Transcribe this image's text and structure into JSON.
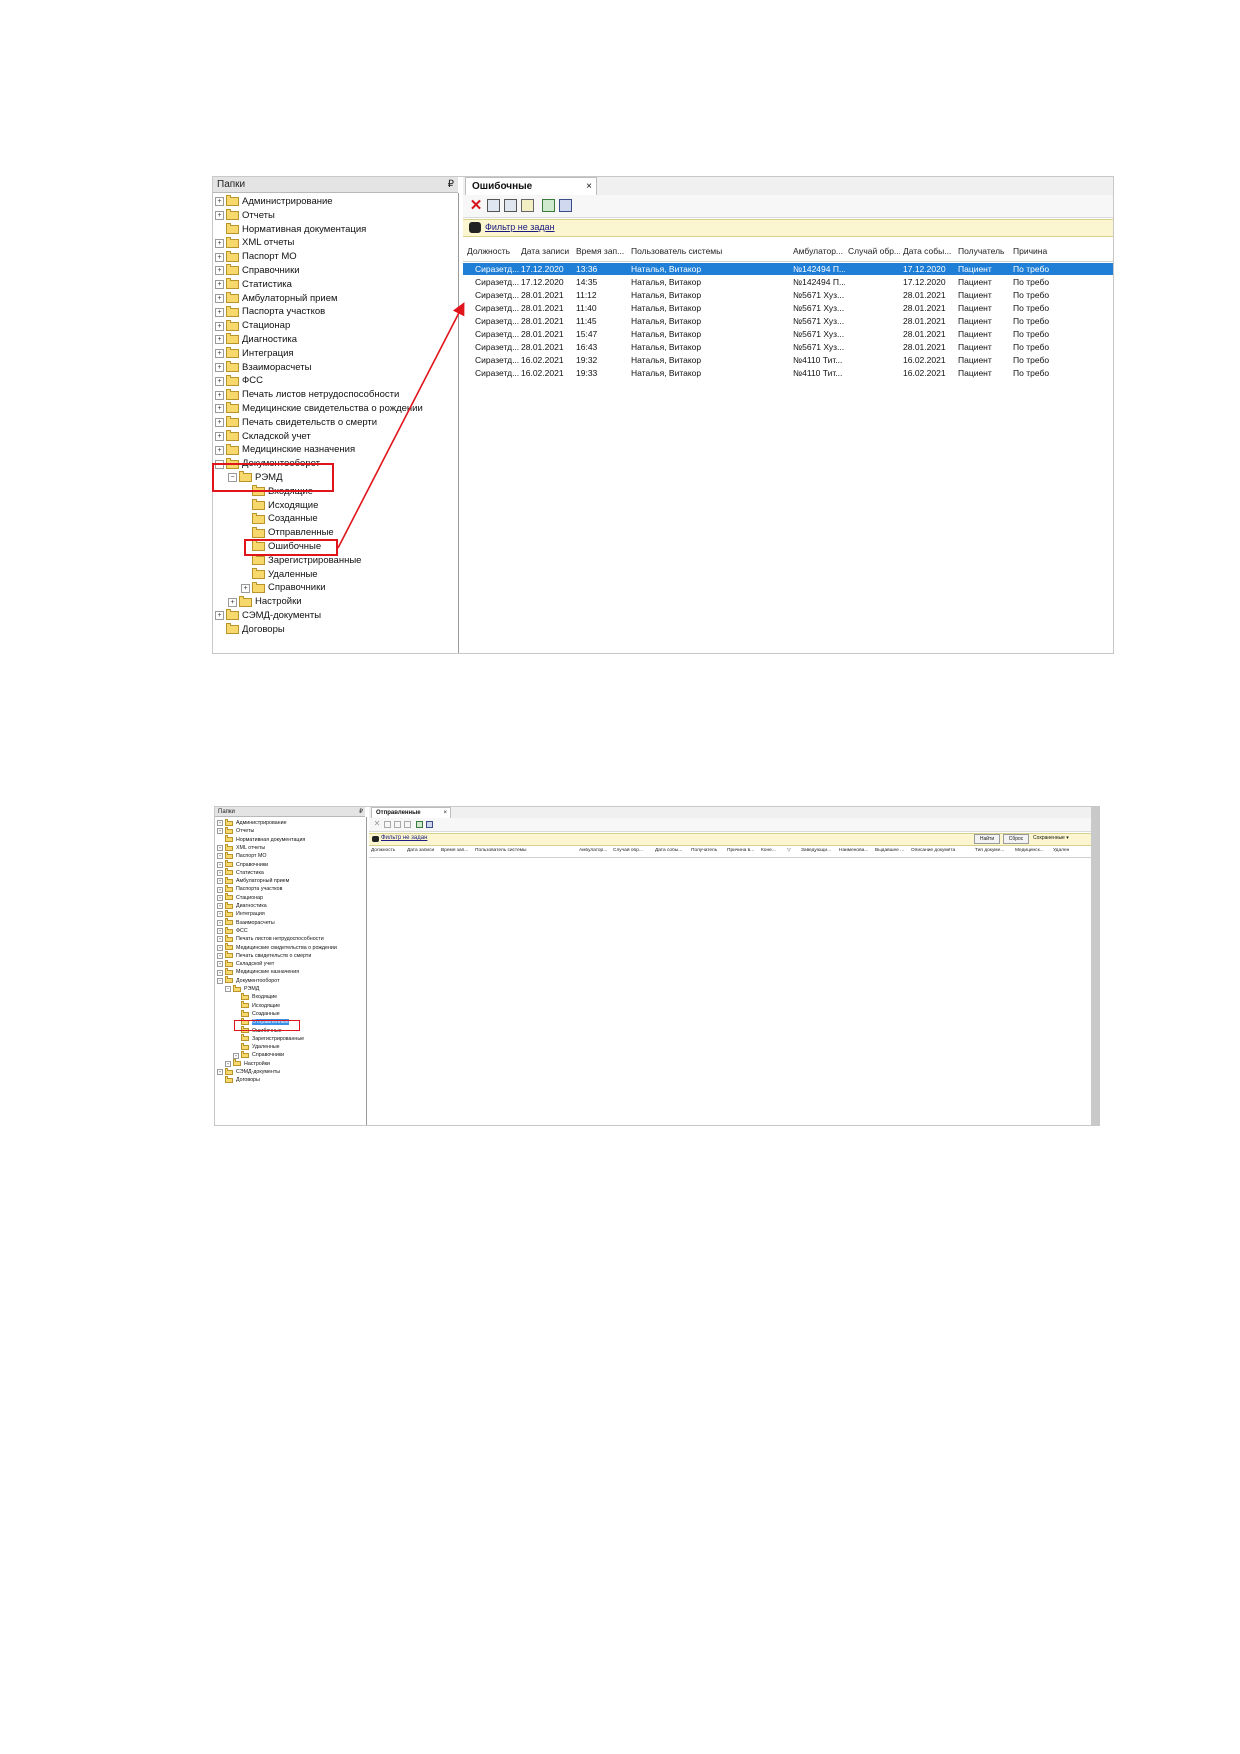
{
  "folders_header": "Папки",
  "pin_glyph": "₽",
  "tree_items": [
    "Администрирование",
    "Отчеты",
    "Нормативная документация",
    "XML отчеты",
    "Паспорт МО",
    "Справочники",
    "Статистика",
    "Амбулаторный прием",
    "Паспорта участков",
    "Стационар",
    "Диагностика",
    "Интеграция",
    "Взаиморасчеты",
    "ФСС",
    "Печать листов нетрудоспособности",
    "Медицинские свидетельства о рождении",
    "Печать свидетельств о смерти",
    "Складской учет",
    "Медицинские назначения",
    "Документооборот",
    "РЭМД",
    "Входящие",
    "Исходящие",
    "Созданные",
    "Отправленные",
    "Ошибочные",
    "Зарегистрированные",
    "Удаленные",
    "Справочники",
    "Настройки",
    "СЭМД-документы",
    "Договоры"
  ],
  "shot1": {
    "tab_title": "Ошибочные",
    "tab_close": "×",
    "filter_text": "Фильтр не задан",
    "columns": [
      "Должность",
      "Дата записи",
      "Время зап...",
      "Пользователь системы",
      "Амбулатор...",
      "Случай обр...",
      "Дата собы...",
      "Получатель",
      "Причина"
    ],
    "rows": [
      [
        "Сиразетд...",
        "17.12.2020",
        "13:36",
        "Наталья, Витакор",
        "№142494 П...",
        "",
        "17.12.2020",
        "Пациент",
        "По требо"
      ],
      [
        "Сиразетд...",
        "17.12.2020",
        "14:35",
        "Наталья, Витакор",
        "№142494 П...",
        "",
        "17.12.2020",
        "Пациент",
        "По требо"
      ],
      [
        "Сиразетд...",
        "28.01.2021",
        "11:12",
        "Наталья, Витакор",
        "№5671 Хуз...",
        "",
        "28.01.2021",
        "Пациент",
        "По требо"
      ],
      [
        "Сиразетд...",
        "28.01.2021",
        "11:40",
        "Наталья, Витакор",
        "№5671 Хуз...",
        "",
        "28.01.2021",
        "Пациент",
        "По требо"
      ],
      [
        "Сиразетд...",
        "28.01.2021",
        "11:45",
        "Наталья, Витакор",
        "№5671 Хуз...",
        "",
        "28.01.2021",
        "Пациент",
        "По требо"
      ],
      [
        "Сиразетд...",
        "28.01.2021",
        "15:47",
        "Наталья, Витакор",
        "№5671 Хуз...",
        "",
        "28.01.2021",
        "Пациент",
        "По требо"
      ],
      [
        "Сиразетд...",
        "28.01.2021",
        "16:43",
        "Наталья, Витакор",
        "№5671 Хуз...",
        "",
        "28.01.2021",
        "Пациент",
        "По требо"
      ],
      [
        "Сиразетд...",
        "16.02.2021",
        "19:32",
        "Наталья, Витакор",
        "№4110 Тит...",
        "",
        "16.02.2021",
        "Пациент",
        "По требо"
      ],
      [
        "Сиразетд...",
        "16.02.2021",
        "19:33",
        "Наталья, Витакор",
        "№4110 Тит...",
        "",
        "16.02.2021",
        "Пациент",
        "По требо"
      ]
    ]
  },
  "shot2": {
    "tab_title": "Отправленные",
    "tab_close": "×",
    "filter_text": "Фильтр не задан",
    "find_button": "Найти",
    "reset_button": "Сброс",
    "saved_label": "Сохраненные",
    "columns": [
      "Должность",
      "Дата записи",
      "Время зап...",
      "Пользователь системы",
      "Амбулатор...",
      "Случай обр...",
      "Дата собы...",
      "Получатель",
      "Причина в...",
      "Коне...",
      "▽",
      "Заведующи...",
      "Наименова...",
      "Выдавшее ...",
      "Описание докуме́та",
      "Тип докуме...",
      "Медицинск...",
      "Удален"
    ]
  },
  "colors": {
    "highlight": "#e0151c",
    "selection": "#1f7fd6",
    "filter_bar": "#fbf6cf",
    "folder": "#f6d86c"
  }
}
